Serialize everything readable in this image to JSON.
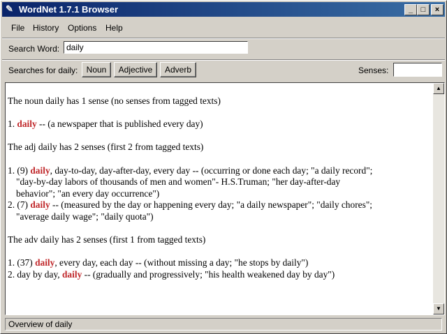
{
  "window": {
    "title": "WordNet 1.7.1 Browser",
    "minimize": "_",
    "maximize": "□",
    "close": "×"
  },
  "menu": {
    "items": [
      "File",
      "History",
      "Options",
      "Help"
    ]
  },
  "search": {
    "label": "Search Word:",
    "value": "daily"
  },
  "searches": {
    "label": "Searches for daily:",
    "buttons": [
      "Noun",
      "Adjective",
      "Adverb"
    ],
    "senses_label": "Senses:",
    "senses_value": ""
  },
  "results": {
    "noun_header": "The noun daily has 1 sense (no senses from tagged texts)",
    "noun_1": {
      "num": "1. ",
      "word": "daily",
      "rest": " -- (a newspaper that is published every day)"
    },
    "adj_header": "The adj daily has 2 senses (first 2 from tagged texts)",
    "adj_1": {
      "num": "1. (9) ",
      "word": "daily",
      "rest": ", day-to-day, day-after-day, every day -- (occurring or done each day; \"a daily record\";",
      "cont1": "\"day-by-day labors of thousands of men and women\"- H.S.Truman; \"her day-after-day",
      "cont2": "behavior\"; \"an every day occurrence\")"
    },
    "adj_2": {
      "num": "2. (7) ",
      "word": "daily",
      "rest": " -- (measured by the day or happening every day; \"a daily newspaper\"; \"daily chores\";",
      "cont1": "\"average daily wage\"; \"daily quota\")"
    },
    "adv_header": "The adv daily has 2 senses (first 1 from tagged texts)",
    "adv_1": {
      "num": "1. (37) ",
      "word": "daily",
      "rest": ", every day, each day -- (without missing a day; \"he stops by daily\")"
    },
    "adv_2": {
      "num": "2. day by day, ",
      "word": "daily",
      "rest": " -- (gradually and progressively; \"his health weakened day by day\")"
    }
  },
  "status": {
    "text": "Overview of daily"
  },
  "colors": {
    "highlight": "#c0282b",
    "titlebar": "#0a246a"
  },
  "icons": {
    "app": "quill-icon",
    "scroll_up": "arrow-up-icon",
    "scroll_down": "arrow-down-icon"
  }
}
